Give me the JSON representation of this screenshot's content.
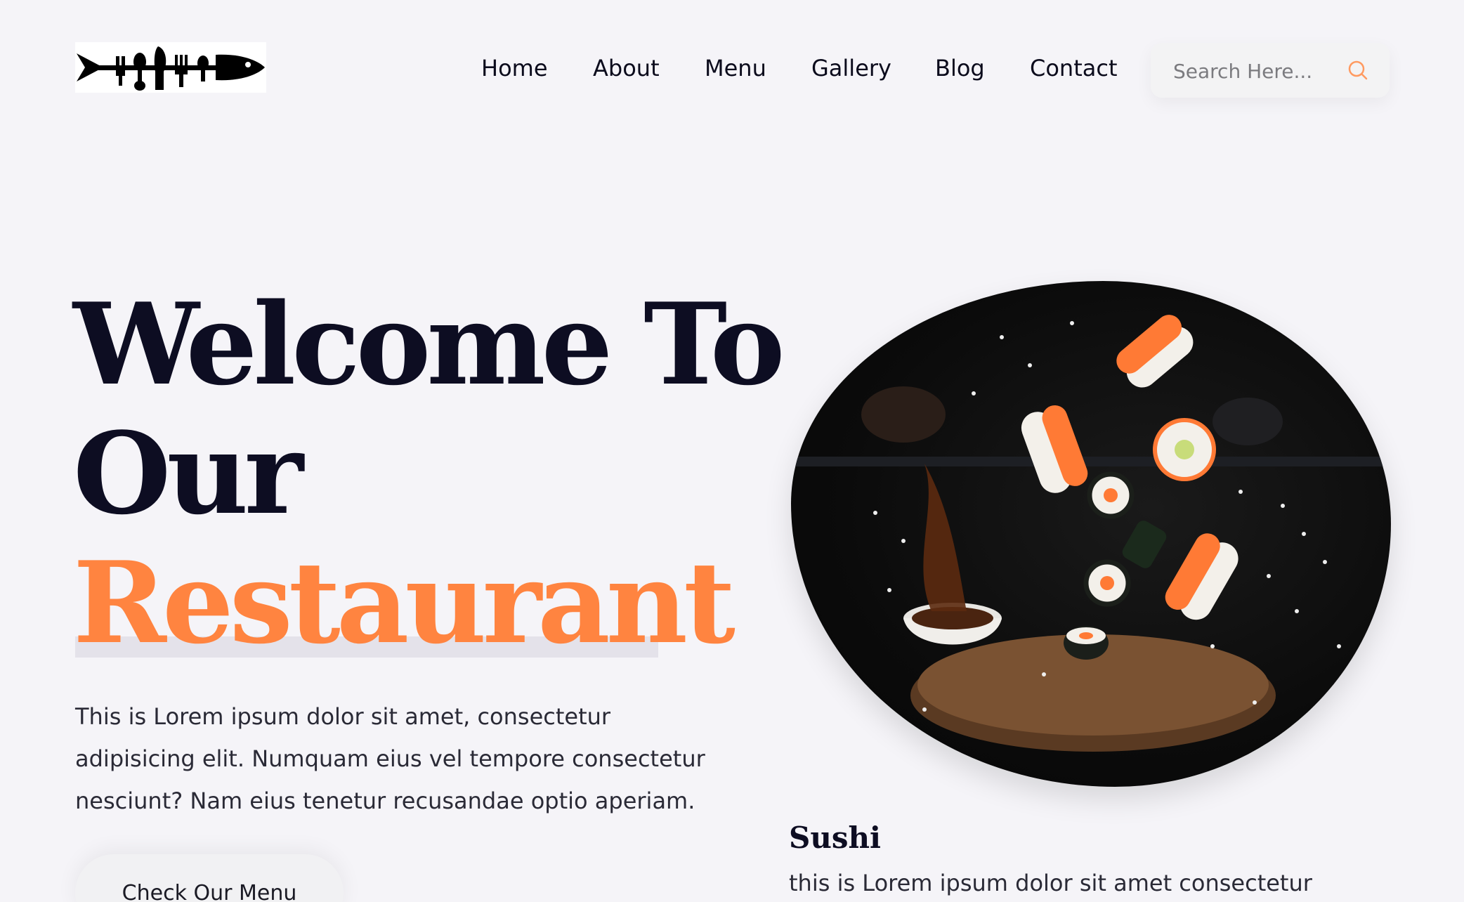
{
  "nav": {
    "items": [
      "Home",
      "About",
      "Menu",
      "Gallery",
      "Blog",
      "Contact"
    ]
  },
  "search": {
    "placeholder": "Search Here..."
  },
  "hero": {
    "line1": "Welcome To",
    "line2": "Our",
    "line3": "Restaurant",
    "description": "This is Lorem ipsum dolor sit amet, consectetur adipisicing elit. Numquam eius vel tempore consectetur nesciunt? Nam eius tenetur recusandae optio aperiam.",
    "cta_label": "Check Our Menu"
  },
  "featured": {
    "name": "Sushi",
    "description": "this is Lorem ipsum dolor sit amet consectetur"
  },
  "colors": {
    "accent": "#ff8440",
    "heading": "#0d0d22",
    "background": "#f5f4f8"
  },
  "icons": {
    "search": "search-icon",
    "logo": "fish-cutlery-logo"
  }
}
